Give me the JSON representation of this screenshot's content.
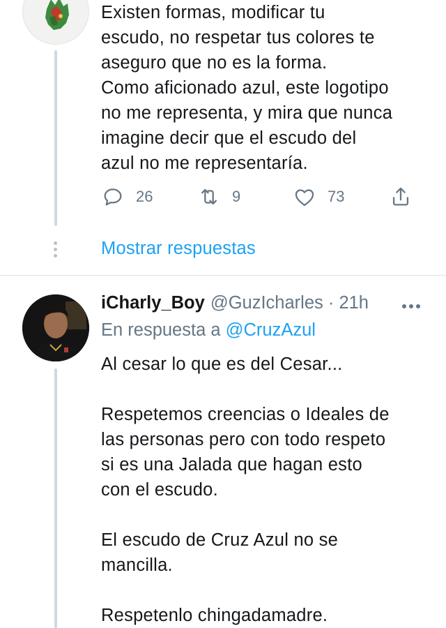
{
  "tweet1": {
    "text": "Existen formas, modificar tu\nescudo, no respetar tus colores te\naseguro que no es la forma.\nComo aficionado azul, este logotipo\nno me representa, y mira que nunca\nimagine decir que el escudo del\nazul no me representaría.",
    "actions": {
      "reply_count": "26",
      "retweet_count": "9",
      "like_count": "73",
      "reply_icon": "reply-icon",
      "retweet_icon": "retweet-icon",
      "like_icon": "heart-icon",
      "share_icon": "share-icon"
    },
    "show_replies_label": "Mostrar respuestas"
  },
  "tweet2": {
    "display_name": "iCharly_Boy",
    "handle": "@GuzIcharles",
    "separator": " · ",
    "time": "21h",
    "reply_prefix": "En respuesta a ",
    "reply_mention": "@CruzAzul",
    "text": "Al cesar lo que es del Cesar...\n\nRespetemos creencias o Ideales de\nlas personas pero con todo respeto\nsi es una Jalada que hagan esto\ncon el escudo.\n\nEl escudo de Cruz Azul no se\nmancilla.\n\nRespetenlo chingadamadre."
  },
  "colors": {
    "accent": "#1da1f2",
    "muted": "#657786",
    "text": "#14171a"
  }
}
